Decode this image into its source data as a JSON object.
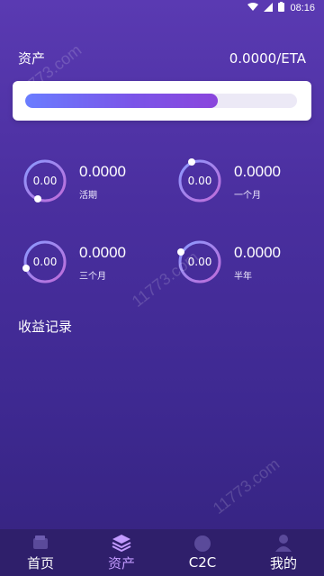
{
  "status": {
    "time": "08:16"
  },
  "header": {
    "title": "资产",
    "balance": "0.0000/ETA"
  },
  "progress": {
    "fraction": 0.71
  },
  "stats": [
    {
      "ring": "0.00",
      "value": "0.0000",
      "caption": "活期"
    },
    {
      "ring": "0.00",
      "value": "0.0000",
      "caption": "一个月"
    },
    {
      "ring": "0.00",
      "value": "0.0000",
      "caption": "三个月"
    },
    {
      "ring": "0.00",
      "value": "0.0000",
      "caption": "半年"
    }
  ],
  "section": {
    "title": "收益记录"
  },
  "tabs": [
    {
      "label": "首页",
      "icon": "wallet-icon",
      "active": false
    },
    {
      "label": "资产",
      "icon": "layers-icon",
      "active": true
    },
    {
      "label": "C2C",
      "icon": "c2c-badge-icon",
      "active": false
    },
    {
      "label": "我的",
      "icon": "person-icon",
      "active": false
    }
  ],
  "watermark": {
    "text": "11773.com"
  },
  "colors": {
    "active_tab": "#c39bff",
    "tabbar": "#2f1f6b",
    "ring_start": "#8a9bff",
    "ring_end": "#c06ad8"
  }
}
